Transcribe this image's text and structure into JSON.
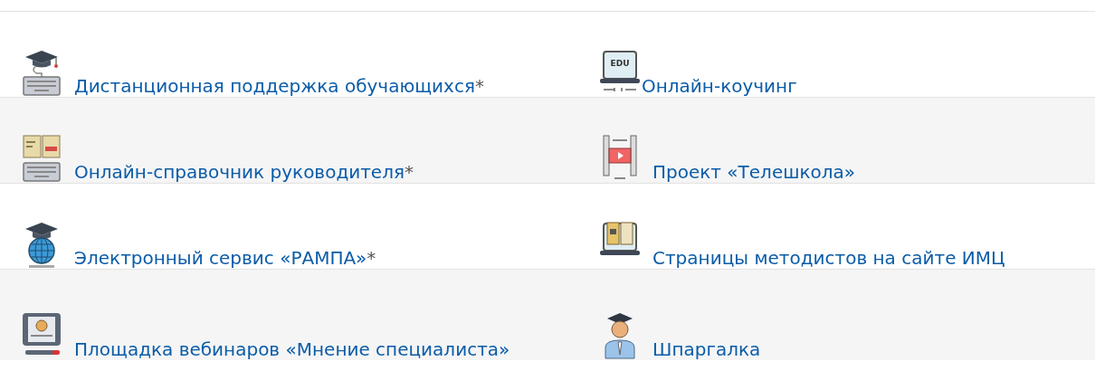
{
  "rows": [
    {
      "cells": [
        {
          "title": "Дистанционная поддержка обучающихся",
          "note": "*"
        },
        {
          "icon_text": "EDU",
          "title": "Онлайн-коучинг"
        }
      ]
    },
    {
      "cells": [
        {
          "title": "Онлайн-справочник руководителя",
          "note": "*"
        },
        {
          "title": "Проект «Телешкола»"
        }
      ]
    },
    {
      "cells": [
        {
          "title": "Электронный сервис «РАМПА»",
          "note": "*"
        },
        {
          "title": "Страницы методистов на сайте ИМЦ"
        }
      ]
    },
    {
      "cells": [
        {
          "title": "Площадка вебинаров «Мнение специалиста»"
        },
        {
          "title": "Шпаргалка"
        }
      ]
    }
  ]
}
